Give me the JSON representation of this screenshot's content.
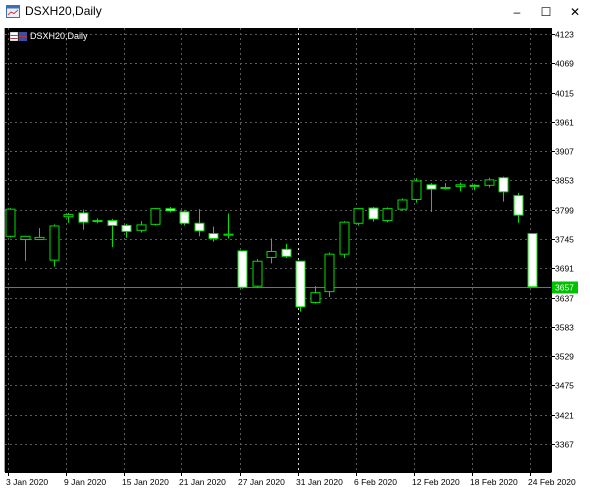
{
  "window": {
    "title": "DSXH20,Daily",
    "controls": {
      "minimize": "–",
      "maximize": "☐",
      "close": "✕"
    }
  },
  "chart_title": "DSXH20,Daily",
  "colors": {
    "background": "#000000",
    "axis": "#ffffff",
    "grid": "#5a5a5a",
    "candle_stroke": "#00e000",
    "bull_fill": "#000000",
    "bear_fill": "#ffffff",
    "price_line": "#00c000",
    "current_price_label_bg": "#00c000"
  },
  "chart_data": {
    "type": "candlestick",
    "symbol": "DSXH20",
    "timeframe": "Daily",
    "ylim": [
      3313,
      4131
    ],
    "y_ticks": [
      4123,
      4069,
      4015,
      3961,
      3907,
      3853,
      3799,
      3745,
      3691,
      3637,
      3583,
      3529,
      3475,
      3421,
      3367
    ],
    "x_labels": [
      "3 Jan 2020",
      "9 Jan 2020",
      "15 Jan 2020",
      "21 Jan 2020",
      "27 Jan 2020",
      "31 Jan 2020",
      "6 Feb 2020",
      "12 Feb 2020",
      "18 Feb 2020",
      "24 Feb 2020"
    ],
    "current_price": 3657,
    "current_price_label": "3657",
    "candles": [
      {
        "o": 3750,
        "h": 3802,
        "l": 3748,
        "c": 3800
      },
      {
        "o": 3744,
        "h": 3751,
        "l": 3705,
        "c": 3750
      },
      {
        "o": 3744,
        "h": 3765,
        "l": 3744,
        "c": 3748
      },
      {
        "o": 3706,
        "h": 3772,
        "l": 3694,
        "c": 3769
      },
      {
        "o": 3786,
        "h": 3793,
        "l": 3775,
        "c": 3790
      },
      {
        "o": 3793,
        "h": 3799,
        "l": 3762,
        "c": 3776
      },
      {
        "o": 3778,
        "h": 3783,
        "l": 3774,
        "c": 3779
      },
      {
        "o": 3779,
        "h": 3782,
        "l": 3730,
        "c": 3770
      },
      {
        "o": 3770,
        "h": 3773,
        "l": 3747,
        "c": 3759
      },
      {
        "o": 3761,
        "h": 3778,
        "l": 3757,
        "c": 3771
      },
      {
        "o": 3772,
        "h": 3802,
        "l": 3770,
        "c": 3801
      },
      {
        "o": 3801,
        "h": 3804,
        "l": 3794,
        "c": 3797
      },
      {
        "o": 3795,
        "h": 3798,
        "l": 3770,
        "c": 3774
      },
      {
        "o": 3774,
        "h": 3800,
        "l": 3750,
        "c": 3760
      },
      {
        "o": 3755,
        "h": 3768,
        "l": 3740,
        "c": 3746
      },
      {
        "o": 3752,
        "h": 3792,
        "l": 3746,
        "c": 3754
      },
      {
        "o": 3723,
        "h": 3723,
        "l": 3653,
        "c": 3656
      },
      {
        "o": 3658,
        "h": 3708,
        "l": 3655,
        "c": 3704
      },
      {
        "o": 3711,
        "h": 3746,
        "l": 3700,
        "c": 3722
      },
      {
        "o": 3726,
        "h": 3736,
        "l": 3710,
        "c": 3713
      },
      {
        "o": 3704,
        "h": 3705,
        "l": 3611,
        "c": 3620
      },
      {
        "o": 3628,
        "h": 3658,
        "l": 3626,
        "c": 3646
      },
      {
        "o": 3648,
        "h": 3720,
        "l": 3638,
        "c": 3717
      },
      {
        "o": 3717,
        "h": 3778,
        "l": 3710,
        "c": 3776
      },
      {
        "o": 3774,
        "h": 3802,
        "l": 3770,
        "c": 3801
      },
      {
        "o": 3802,
        "h": 3804,
        "l": 3777,
        "c": 3782
      },
      {
        "o": 3779,
        "h": 3803,
        "l": 3776,
        "c": 3801
      },
      {
        "o": 3800,
        "h": 3820,
        "l": 3797,
        "c": 3817
      },
      {
        "o": 3818,
        "h": 3857,
        "l": 3812,
        "c": 3852
      },
      {
        "o": 3845,
        "h": 3848,
        "l": 3795,
        "c": 3837
      },
      {
        "o": 3838,
        "h": 3848,
        "l": 3836,
        "c": 3840
      },
      {
        "o": 3842,
        "h": 3849,
        "l": 3833,
        "c": 3845
      },
      {
        "o": 3844,
        "h": 3846,
        "l": 3835,
        "c": 3842
      },
      {
        "o": 3844,
        "h": 3858,
        "l": 3840,
        "c": 3854
      },
      {
        "o": 3858,
        "h": 3860,
        "l": 3814,
        "c": 3832
      },
      {
        "o": 3825,
        "h": 3830,
        "l": 3775,
        "c": 3789
      },
      {
        "o": 3755,
        "h": 3755,
        "l": 3657,
        "c": 3657
      }
    ]
  }
}
